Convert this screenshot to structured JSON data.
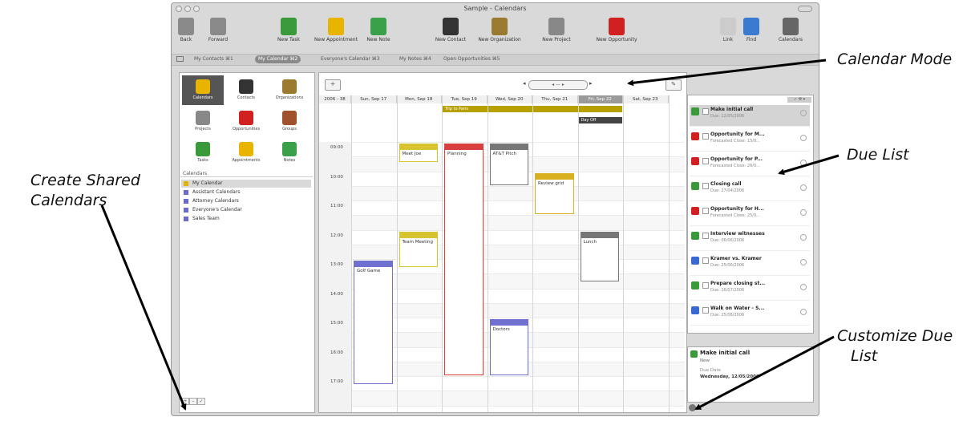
{
  "window": {
    "title": "Sample - Calendars"
  },
  "toolbar": [
    {
      "label": "Back",
      "icon": "back-arrow-icon",
      "color": "#8a8a8a"
    },
    {
      "label": "Forward",
      "icon": "forward-arrow-icon",
      "color": "#8a8a8a"
    },
    {
      "label": "New Task",
      "icon": "task-icon",
      "color": "#3a9a3a"
    },
    {
      "label": "New Appointment",
      "icon": "clock-icon",
      "color": "#e8b400"
    },
    {
      "label": "New Note",
      "icon": "note-icon",
      "color": "#3aa04a"
    },
    {
      "label": "New Contact",
      "icon": "contact-icon",
      "color": "#333333"
    },
    {
      "label": "New Organization",
      "icon": "organization-icon",
      "color": "#9a7a30"
    },
    {
      "label": "New Project",
      "icon": "project-icon",
      "color": "#888888"
    },
    {
      "label": "New Opportunity",
      "icon": "opportunity-icon",
      "color": "#d02020"
    },
    {
      "label": "Link",
      "icon": "link-icon",
      "color": "#cccccc"
    },
    {
      "label": "Find",
      "icon": "find-icon",
      "color": "#3a7ad0"
    },
    {
      "label": "Calendars",
      "icon": "calendar-icon",
      "color": "#666666"
    }
  ],
  "tabs": [
    {
      "label": "My Contacts ⌘1",
      "active": false
    },
    {
      "label": "My Calendar ⌘2",
      "active": true
    },
    {
      "label": "Everyone's Calendar ⌘3",
      "active": false
    },
    {
      "label": "My Notes ⌘4",
      "active": false
    },
    {
      "label": "Open Opportunities ⌘5",
      "active": false
    }
  ],
  "modes": [
    {
      "label": "Calendars",
      "color": "#e8b400",
      "selected": true
    },
    {
      "label": "Contacts",
      "color": "#333333",
      "selected": false
    },
    {
      "label": "Organizations",
      "color": "#9a7a30",
      "selected": false
    },
    {
      "label": "Projects",
      "color": "#888888",
      "selected": false
    },
    {
      "label": "Opportunities",
      "color": "#d02020",
      "selected": false
    },
    {
      "label": "Groups",
      "color": "#a0522d",
      "selected": false
    },
    {
      "label": "Tasks",
      "color": "#3a9a3a",
      "selected": false
    },
    {
      "label": "Appointments",
      "color": "#e8b400",
      "selected": false
    },
    {
      "label": "Notes",
      "color": "#3aa04a",
      "selected": false
    }
  ],
  "calendars": {
    "header": "Calendars",
    "items": [
      {
        "label": "My Calendar",
        "selected": true
      },
      {
        "label": "Assistant Calendars",
        "selected": false
      },
      {
        "label": "Attorney Calendars",
        "selected": false
      },
      {
        "label": "Everyone's Calendar",
        "selected": false
      },
      {
        "label": "Sales Team",
        "selected": false
      }
    ]
  },
  "left_buttons": [
    "+",
    "–",
    "✓"
  ],
  "calendar": {
    "week_label": "2006 - 38",
    "nav_label": "◂ — ▸",
    "days": [
      {
        "label": "Sun, Sep 17",
        "today": false
      },
      {
        "label": "Mon, Sep 18",
        "today": false
      },
      {
        "label": "Tue, Sep 19",
        "today": false
      },
      {
        "label": "Wed, Sep 20",
        "today": false
      },
      {
        "label": "Thu, Sep 21",
        "today": false
      },
      {
        "label": "Fri, Sep 22",
        "today": true
      },
      {
        "label": "Sat, Sep 23",
        "today": false
      }
    ],
    "allday": [
      {
        "title": "Trip to Paris",
        "day": 2,
        "span": 4,
        "color": "#b8a000"
      },
      {
        "title": "Day Off",
        "day": 5,
        "span": 1,
        "color": "#444444"
      }
    ],
    "hours": [
      "09:00",
      "10:00",
      "11:00",
      "12:00",
      "13:00",
      "14:00",
      "15:00",
      "16:00",
      "17:00"
    ],
    "events": [
      {
        "title": "Meet Joe",
        "day": 1,
        "start": 9,
        "end": 9.7,
        "color": "#d8c430"
      },
      {
        "title": "Planning",
        "day": 2,
        "start": 9,
        "end": 17,
        "color": "#d84040"
      },
      {
        "title": "AT&T Pitch",
        "day": 3,
        "start": 9,
        "end": 10.5,
        "color": "#777777"
      },
      {
        "title": "Review grid",
        "day": 4,
        "start": 10,
        "end": 11.5,
        "color": "#d8b020"
      },
      {
        "title": "Team Meeting",
        "day": 1,
        "start": 12,
        "end": 13.3,
        "color": "#d8c430"
      },
      {
        "title": "Lunch",
        "day": 5,
        "start": 12,
        "end": 13.8,
        "color": "#777777"
      },
      {
        "title": "Golf Game",
        "day": 0,
        "start": 13,
        "end": 17.3,
        "color": "#7070d0"
      },
      {
        "title": "Doctors",
        "day": 3,
        "start": 15,
        "end": 17,
        "color": "#7070d0"
      }
    ]
  },
  "due_list": {
    "items": [
      {
        "title": "Make initial call",
        "sub": "Due: 12/05/2006",
        "color": "#3a9a3a",
        "selected": true
      },
      {
        "title": "Opportunity for M...",
        "sub": "Forecasted Close: 15/0...",
        "color": "#d02020",
        "selected": false
      },
      {
        "title": "Opportunity for P...",
        "sub": "Forecasted Close: 26/0...",
        "color": "#d02020",
        "selected": false
      },
      {
        "title": "Closing call",
        "sub": "Due: 27/04/2006",
        "color": "#3a9a3a",
        "selected": false
      },
      {
        "title": "Opportunity for H...",
        "sub": "Forecasted Close: 25/0...",
        "color": "#d02020",
        "selected": false
      },
      {
        "title": "Interview witnesses",
        "sub": "Due: 06/06/2006",
        "color": "#3a9a3a",
        "selected": false
      },
      {
        "title": "Kramer vs. Kramer",
        "sub": "Due: 25/06/2006",
        "color": "#3a6ad0",
        "selected": false
      },
      {
        "title": "Prepare closing st...",
        "sub": "Due: 16/07/2006",
        "color": "#3a9a3a",
        "selected": false
      },
      {
        "title": "Walk on Water - S...",
        "sub": "Due: 25/08/2006",
        "color": "#3a6ad0",
        "selected": false
      }
    ],
    "detail": {
      "title": "Make initial call",
      "sub": "New",
      "field_label": "Due Date",
      "field_value": "Wednesday, 12/05/2006"
    }
  },
  "annotations": {
    "calendar_mode": "Calendar Mode",
    "due_list": "Due List",
    "create_shared_line1": "Create Shared",
    "create_shared_line2": "Calendars",
    "customize_due_line1": "Customize Due",
    "customize_due_line2": "List"
  }
}
